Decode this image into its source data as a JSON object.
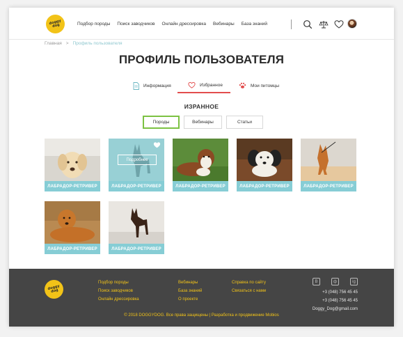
{
  "logo": {
    "text": "doggy dog"
  },
  "nav": {
    "items": [
      "Подбор породы",
      "Поиск заводчиков",
      "Онлайн дрессировка",
      "Вебинары",
      "База знаний"
    ]
  },
  "header_icons": [
    "search-icon",
    "scales-icon",
    "heart-icon",
    "avatar"
  ],
  "breadcrumb": {
    "home": "Главная",
    "separator": ">",
    "current": "Профиль пользователя"
  },
  "page_title": "ПРОФИЛЬ ПОЛЬЗОВАТЕЛЯ",
  "profile_tabs": [
    {
      "label": "Информация",
      "icon": "document-icon"
    },
    {
      "label": "Избранное",
      "icon": "heart-icon",
      "active": true
    },
    {
      "label": "Мои питомцы",
      "icon": "paw-icon"
    }
  ],
  "favorites": {
    "title": "ИЗРАННОЕ",
    "filters": [
      {
        "label": "Породы",
        "active": true
      },
      {
        "label": "Вебинары"
      },
      {
        "label": "Статьи"
      }
    ],
    "more_button": "Подробнее",
    "cards": [
      {
        "label": "ЛАБРАДОР-РЕТРИВЕР"
      },
      {
        "label": "ЛАБРАДОР-РЕТРИВЕР"
      },
      {
        "label": "ЛАБРАДОР-РЕТРИВЕР"
      },
      {
        "label": "ЛАБРАДОР-РЕТРИВЕР"
      },
      {
        "label": "ЛАБРАДОР-РЕТРИВЕР"
      },
      {
        "label": "ЛАБРАДОР-РЕТРИВЕР"
      },
      {
        "label": "ЛАБРАДОР-РЕТРИВЕР"
      }
    ]
  },
  "footer": {
    "col1": [
      "Подбор породы",
      "Поиск заводчиков",
      "Онлайн дрессировка"
    ],
    "col2": [
      "Вебинары",
      "База знаний",
      "О проекте"
    ],
    "col3": [
      "Справка по сайту",
      "Связаться с нами"
    ],
    "socials": [
      "В",
      "ф",
      "ig"
    ],
    "phones": [
      "+3 (048) 756 45 45",
      "+3 (048) 756 45 45"
    ],
    "email": "Doggy_Dog@gmail.com",
    "copyright": "© 2018 DOGGYDOG. Все права защищены | Разработка и продвижение Mobios"
  },
  "colors": {
    "accent_teal": "#86cdd5",
    "accent_yellow": "#f2c318",
    "active_red": "#e24d4d",
    "active_green": "#7cc242",
    "footer_bg": "#454545"
  }
}
